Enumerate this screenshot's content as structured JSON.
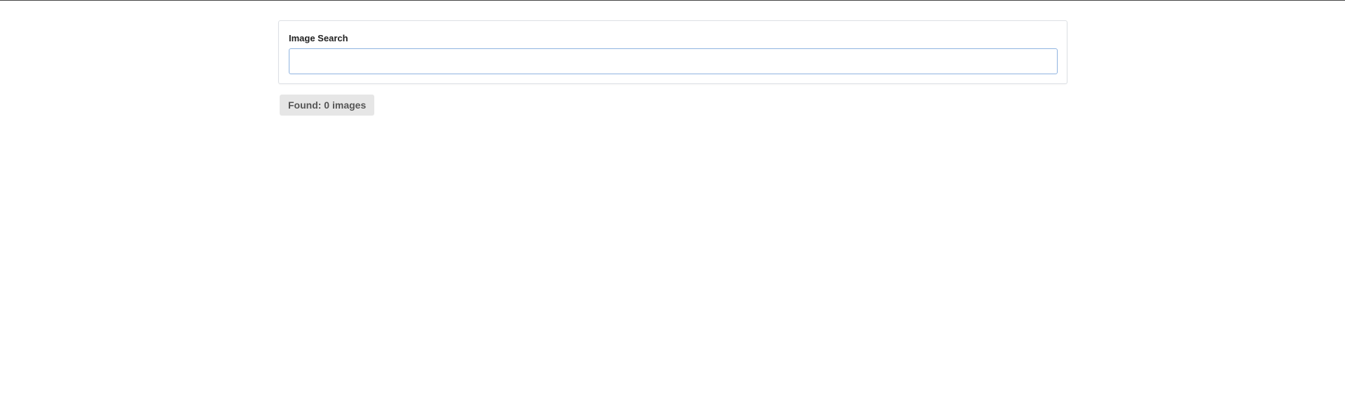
{
  "search": {
    "label": "Image Search",
    "value": "",
    "placeholder": ""
  },
  "results": {
    "summary": "Found: 0 images"
  },
  "colors": {
    "input_border": "#8fb3e0",
    "badge_background": "#e6e6e6",
    "panel_border": "#dcdfe4"
  }
}
